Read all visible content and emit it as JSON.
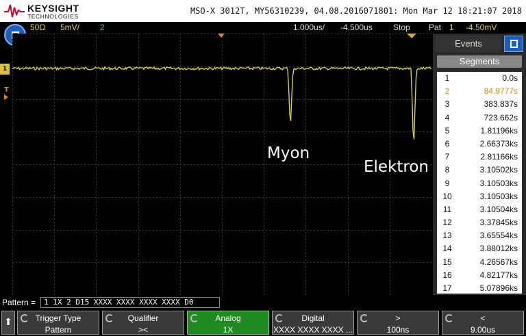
{
  "header": {
    "brand": "KEYSIGHT",
    "brand_sub": "TECHNOLOGIES",
    "info": "MSO-X 3012T, MY56310239, 04.08.2016071801: Mon Mar 12 18:21:07 2018"
  },
  "status": {
    "impedance": "50Ω",
    "scale": "5mV/",
    "channel2": "2",
    "timebase": "1.000us/",
    "delay": "-4.500us",
    "run_state": "Stop",
    "trigger_mode": "Pat",
    "trigger_ch": "1",
    "trigger_level": "-4.50mV"
  },
  "markers": {
    "channel": "1",
    "trigger": "T"
  },
  "annotations": {
    "myon": "Myon",
    "elektron": "Elektron"
  },
  "panel": {
    "tab_events": "Events",
    "segments_header": "Segments",
    "segments": [
      {
        "n": "1",
        "t": "0.0s"
      },
      {
        "n": "2",
        "t": "84.9777s"
      },
      {
        "n": "3",
        "t": "383.837s"
      },
      {
        "n": "4",
        "t": "723.662s"
      },
      {
        "n": "5",
        "t": "1.81196ks"
      },
      {
        "n": "6",
        "t": "2.66373ks"
      },
      {
        "n": "7",
        "t": "2.81166ks"
      },
      {
        "n": "8",
        "t": "3.10502ks"
      },
      {
        "n": "9",
        "t": "3.10503ks"
      },
      {
        "n": "10",
        "t": "3.10503ks"
      },
      {
        "n": "11",
        "t": "3.10504ks"
      },
      {
        "n": "12",
        "t": "3.37845ks"
      },
      {
        "n": "13",
        "t": "3.65554ks"
      },
      {
        "n": "14",
        "t": "3.88012ks"
      },
      {
        "n": "15",
        "t": "4.26567ks"
      },
      {
        "n": "16",
        "t": "4.82177ks"
      },
      {
        "n": "17",
        "t": "5.07896ks"
      }
    ],
    "selected_segment": "2"
  },
  "pattern": {
    "label": "Pattern =",
    "value": "1 1X 2 D15 XXXX XXXX XXXX XXXX D0"
  },
  "softkeys": [
    {
      "id": "trigger-type",
      "top": "Trigger Type",
      "bottom": "Pattern",
      "knob": true,
      "active": false
    },
    {
      "id": "qualifier",
      "top": "Qualifier",
      "bottom": "><",
      "knob": true,
      "active": false
    },
    {
      "id": "analog",
      "top": "Analog",
      "bottom": "1X",
      "knob": true,
      "active": true
    },
    {
      "id": "digital",
      "top": "Digital",
      "bottom": "XXXX XXXX XXXX ...",
      "knob": true,
      "active": false
    },
    {
      "id": "greater",
      "top": ">",
      "bottom": "100ns",
      "knob": true,
      "active": false
    },
    {
      "id": "less",
      "top": "<",
      "bottom": "9.00us",
      "knob": true,
      "active": false
    }
  ],
  "colors": {
    "trace": "#d9d23a",
    "accent_blue": "#1f5fb8",
    "selected": "#e08a1e",
    "active_key": "#1f8a1f"
  }
}
